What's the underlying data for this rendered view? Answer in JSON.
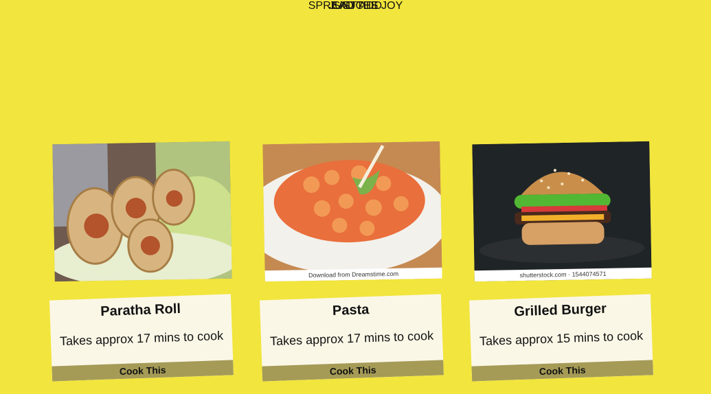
{
  "hero": {
    "pre": "JUST ADD",
    "title": "SAUCES",
    "subtitle": "SPREAD THE JOY"
  },
  "cards": [
    {
      "title": "Paratha Roll",
      "description": "Takes approx 17 mins to cook",
      "button": "Cook This"
    },
    {
      "title": "Pasta",
      "description": "Takes approx 17 mins to cook",
      "button": "Cook This",
      "watermark": "Download from Dreamstime.com"
    },
    {
      "title": "Grilled Burger",
      "description": "Takes approx 15 mins to cook",
      "button": "Cook This",
      "watermark": "shutterstock.com · 1544074571"
    }
  ]
}
